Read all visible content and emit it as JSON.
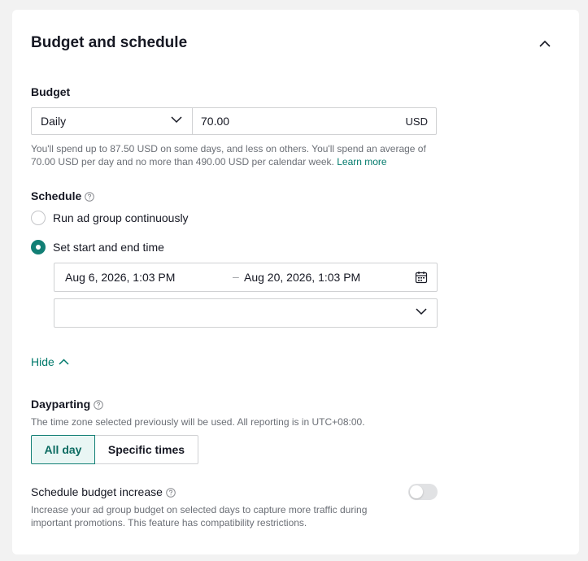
{
  "section": {
    "title": "Budget and schedule"
  },
  "budget": {
    "label": "Budget",
    "type_selected": "Daily",
    "amount": "70.00",
    "currency": "USD",
    "helper_text": "You'll spend up to 87.50 USD on some days, and less on others. You'll spend an average of 70.00 USD per day and no more than 490.00 USD per calendar week.",
    "learn_more": "Learn more"
  },
  "schedule": {
    "label": "Schedule",
    "options": [
      {
        "label": "Run ad group continuously",
        "checked": false
      },
      {
        "label": "Set start and end time",
        "checked": true
      }
    ],
    "start": "Aug 6, 2026, 1:03 PM",
    "separator": "–",
    "end": "Aug 20, 2026, 1:03 PM",
    "timezone_value": ""
  },
  "hide_link": "Hide",
  "dayparting": {
    "label": "Dayparting",
    "helper_text": "The time zone selected previously will be used. All reporting is in UTC+08:00.",
    "options": [
      "All day",
      "Specific times"
    ],
    "selected": "All day"
  },
  "budget_increase": {
    "label": "Schedule budget increase",
    "helper_text": "Increase your ad group budget on selected days to capture more traffic during important promotions. This feature has compatibility restrictions.",
    "enabled": false
  },
  "colors": {
    "accent": "#127f75",
    "link": "#00796b",
    "text": "#161823",
    "muted": "#6b6f76"
  },
  "icons": {
    "collapse": "chevron-up-icon",
    "dropdown": "chevron-down-icon",
    "help": "question-circle-icon",
    "calendar": "calendar-icon"
  }
}
